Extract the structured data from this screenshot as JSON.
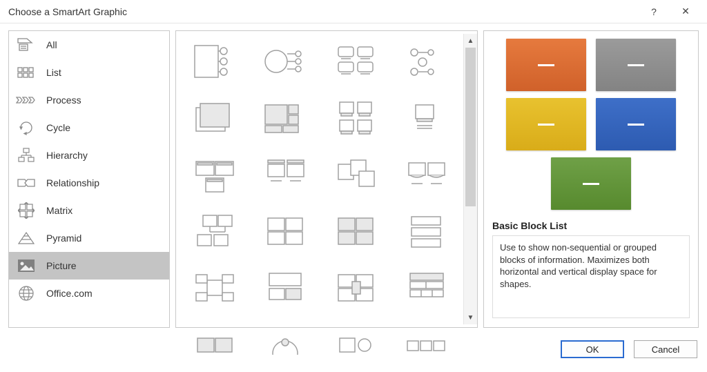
{
  "titlebar": {
    "title": "Choose a SmartArt Graphic",
    "help": "?",
    "close": "✕"
  },
  "categories": {
    "items": [
      {
        "label": "All"
      },
      {
        "label": "List"
      },
      {
        "label": "Process"
      },
      {
        "label": "Cycle"
      },
      {
        "label": "Hierarchy"
      },
      {
        "label": "Relationship"
      },
      {
        "label": "Matrix"
      },
      {
        "label": "Pyramid"
      },
      {
        "label": "Picture"
      },
      {
        "label": "Office.com"
      }
    ],
    "selected_index": 8
  },
  "gallery": {
    "visible_rows": 6,
    "visible_cols": 4,
    "selected_index": null
  },
  "preview": {
    "name": "Basic Block List",
    "description": "Use to show non-sequential or grouped blocks of information. Maximizes both horizontal and vertical display space for shapes.",
    "blocks": [
      "orange",
      "gray",
      "yellow",
      "blue",
      "green"
    ]
  },
  "footer": {
    "ok": "OK",
    "cancel": "Cancel"
  },
  "scrollbar": {
    "up": "▲",
    "down": "▼"
  }
}
